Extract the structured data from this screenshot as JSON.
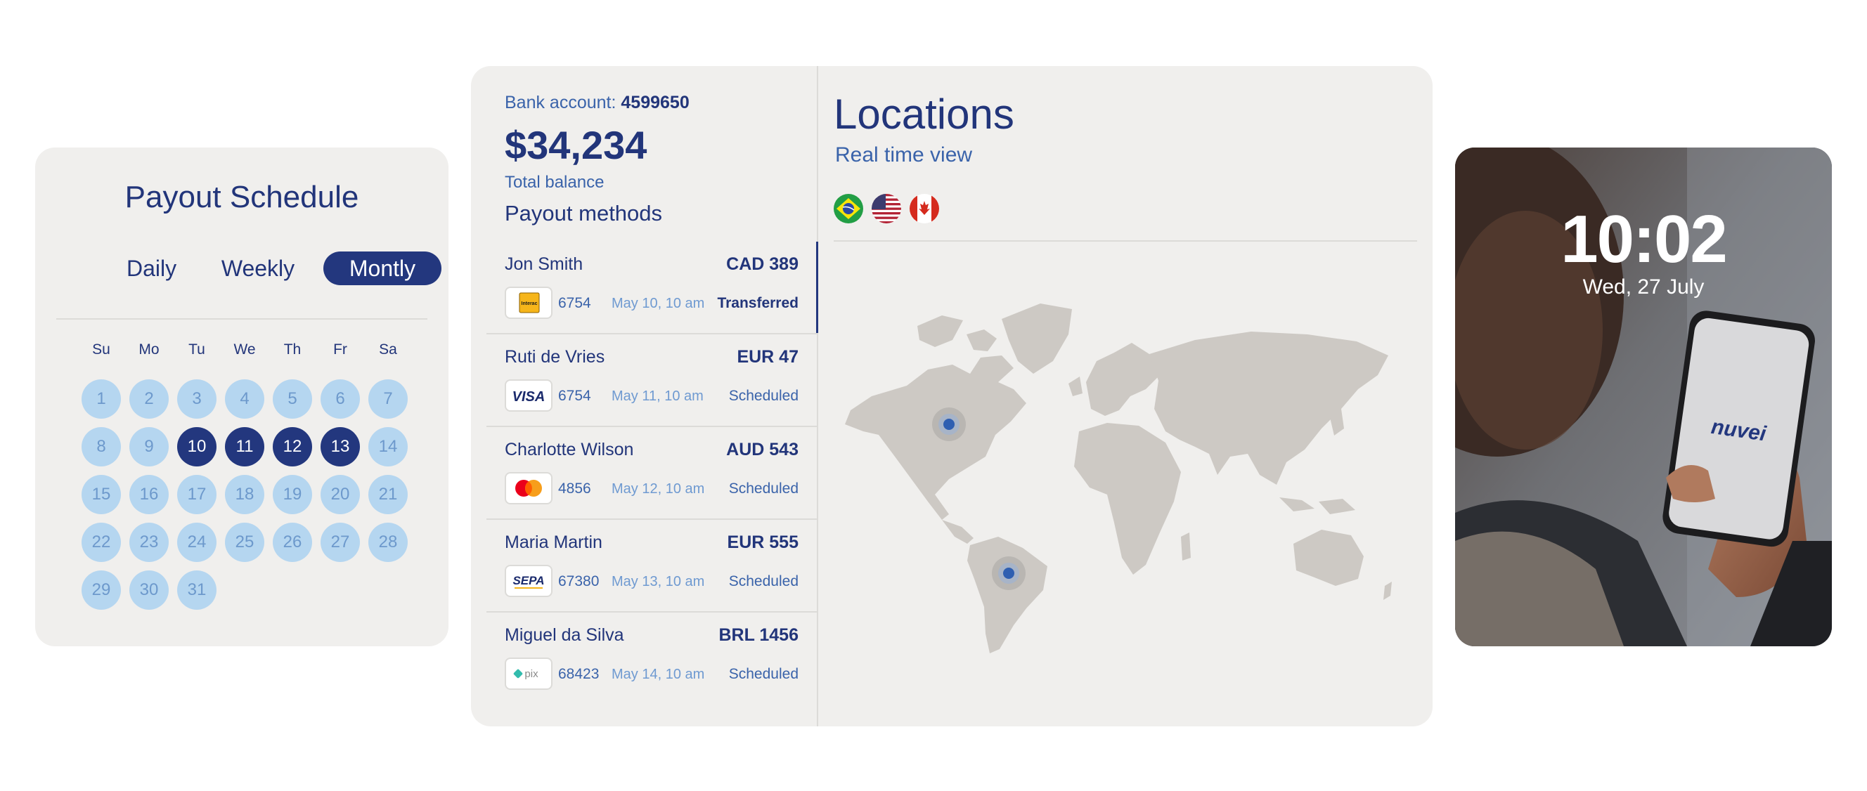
{
  "schedule": {
    "title": "Payout Schedule",
    "tabs": [
      "Daily",
      "Weekly",
      "Montly"
    ],
    "active_tab": "Montly",
    "weekdays": [
      "Su",
      "Mo",
      "Tu",
      "We",
      "Th",
      "Fr",
      "Sa"
    ],
    "days": [
      1,
      2,
      3,
      4,
      5,
      6,
      7,
      8,
      9,
      10,
      11,
      12,
      13,
      14,
      15,
      16,
      17,
      18,
      19,
      20,
      21,
      22,
      23,
      24,
      25,
      26,
      27,
      28,
      29,
      30,
      31
    ],
    "selected_days": [
      10,
      11,
      12,
      13
    ]
  },
  "account": {
    "label": "Bank account:",
    "number": "4599650",
    "balance": "$34,234",
    "balance_label": "Total balance",
    "methods_title": "Payout methods"
  },
  "payouts": [
    {
      "name": "Jon Smith",
      "amount": "CAD 389",
      "method_icon": "interac-logo",
      "card": "6754",
      "date": "May 10, 10 am",
      "status": "Transferred"
    },
    {
      "name": "Ruti de Vries",
      "amount": "EUR 47",
      "method_icon": "visa-logo",
      "card": "6754",
      "date": "May 11, 10 am",
      "status": "Scheduled"
    },
    {
      "name": "Charlotte Wilson",
      "amount": "AUD 543",
      "method_icon": "mastercard-logo",
      "card": "4856",
      "date": "May 12, 10 am",
      "status": "Scheduled"
    },
    {
      "name": "Maria Martin",
      "amount": "EUR 555",
      "method_icon": "sepa-logo",
      "card": "67380",
      "date": "May 13, 10 am",
      "status": "Scheduled"
    },
    {
      "name": "Miguel da Silva",
      "amount": "BRL 1456",
      "method_icon": "pix-logo",
      "card": "68423",
      "date": "May 14, 10 am",
      "status": "Scheduled"
    }
  ],
  "locations": {
    "title": "Locations",
    "subtitle": "Real time view",
    "flags": [
      "brazil-flag",
      "usa-flag",
      "canada-flag"
    ]
  },
  "logos": {
    "interac": "Interac",
    "visa": "VISA",
    "sepa": "SEPA",
    "pix": "pix"
  },
  "phone": {
    "time": "10:02",
    "date": "Wed, 27 July",
    "brand": "nuvei"
  },
  "colors": {
    "navy": "#23377e",
    "light_blue": "#b5d6f0",
    "card_bg": "#f0efed",
    "map_land": "#cdc9c4"
  }
}
